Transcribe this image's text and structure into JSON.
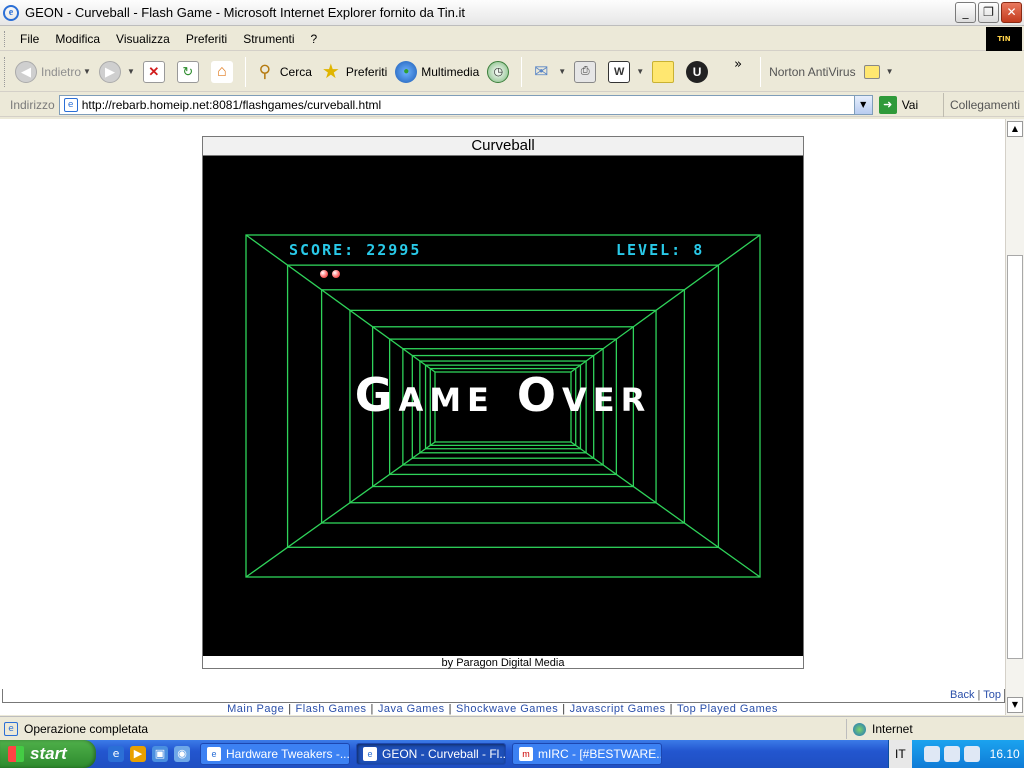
{
  "window": {
    "title": "GEON - Curveball - Flash Game - Microsoft Internet Explorer fornito da Tin.it",
    "buttons": {
      "minimize": "_",
      "maximize": "❐",
      "close": "✕"
    }
  },
  "menu": {
    "items": [
      "File",
      "Modifica",
      "Visualizza",
      "Preferiti",
      "Strumenti",
      "?"
    ]
  },
  "toolbar": {
    "back_label": "Indietro",
    "search_label": "Cerca",
    "favorites_label": "Preferiti",
    "media_label": "Multimedia",
    "more": "»",
    "norton_label": "Norton AntiVirus"
  },
  "address": {
    "label": "Indirizzo",
    "url": "http://rebarb.homeip.net:8081/flashgames/curveball.html",
    "go_label": "Vai",
    "links_label": "Collegamenti"
  },
  "game": {
    "title": "Curveball",
    "score_label": "SCORE:",
    "score": "22995",
    "level_label": "LEVEL:",
    "level": "8",
    "message": "Game Over",
    "credit": "by Paragon Digital Media",
    "lives": 2,
    "colors": {
      "tunnel": "#2fd35a",
      "hud": "#29c9e8",
      "background": "#000000"
    }
  },
  "page": {
    "back_link": "Back",
    "top_link": "Top",
    "nav": [
      "Main Page",
      "Flash Games",
      "Java Games",
      "Shockwave Games",
      "Javascript Games",
      "Top Played Games"
    ]
  },
  "status": {
    "text": "Operazione completata",
    "zone": "Internet"
  },
  "taskbar": {
    "start_label": "start",
    "tasks": [
      "Hardware Tweakers -...",
      "GEON - Curveball - Fl...",
      "mIRC - [#BESTWARE..."
    ],
    "language": "IT",
    "clock": "16.10"
  }
}
